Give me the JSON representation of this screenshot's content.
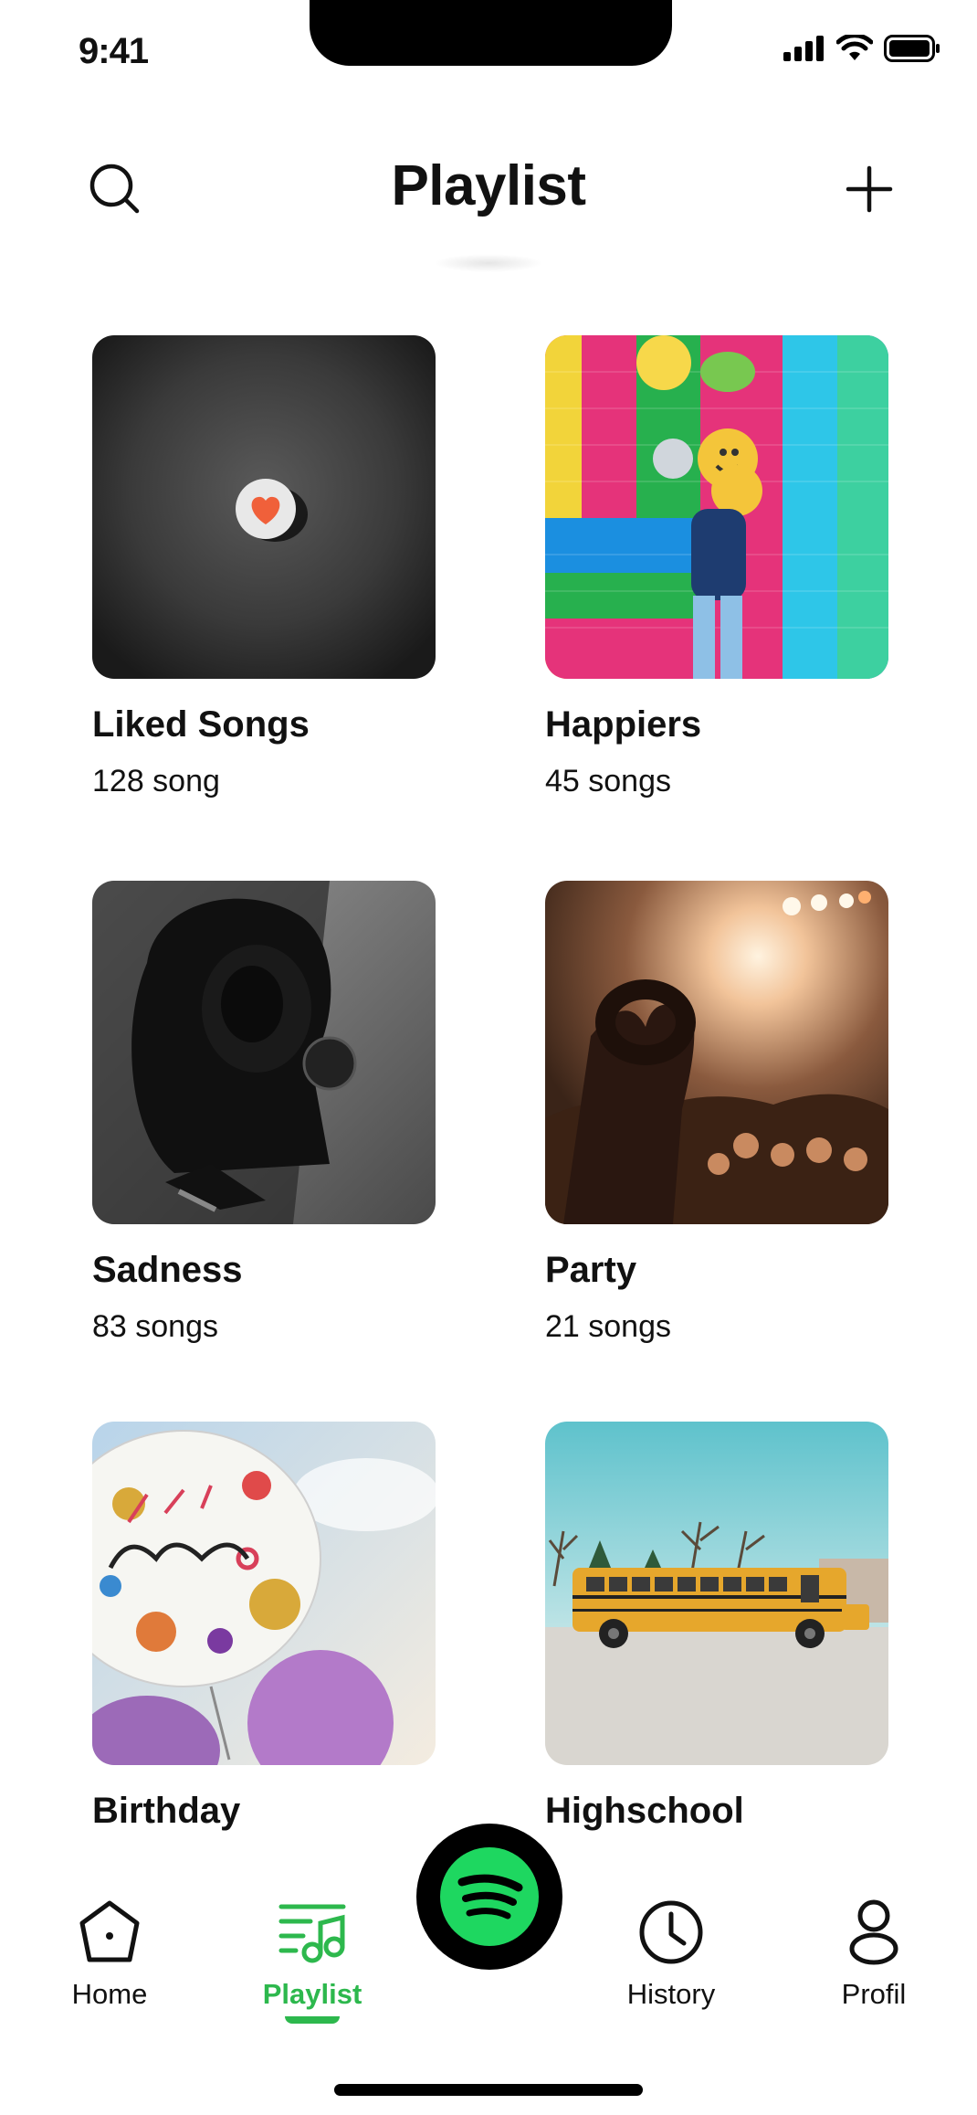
{
  "status_bar": {
    "time": "9:41"
  },
  "header": {
    "title": "Playlist"
  },
  "playlists": [
    {
      "title": "Liked Songs",
      "count": "128 song"
    },
    {
      "title": "Happiers",
      "count": "45 songs"
    },
    {
      "title": "Sadness",
      "count": "83 songs"
    },
    {
      "title": "Party",
      "count": "21 songs"
    },
    {
      "title": "Birthday",
      "count": ""
    },
    {
      "title": "Highschool",
      "count": ""
    }
  ],
  "nav": {
    "home": "Home",
    "playlist": "Playlist",
    "history": "History",
    "profile": "Profil",
    "active": "playlist"
  },
  "colors": {
    "accent": "#2db84d",
    "spotify_green": "#1ed760",
    "text": "#111111"
  }
}
